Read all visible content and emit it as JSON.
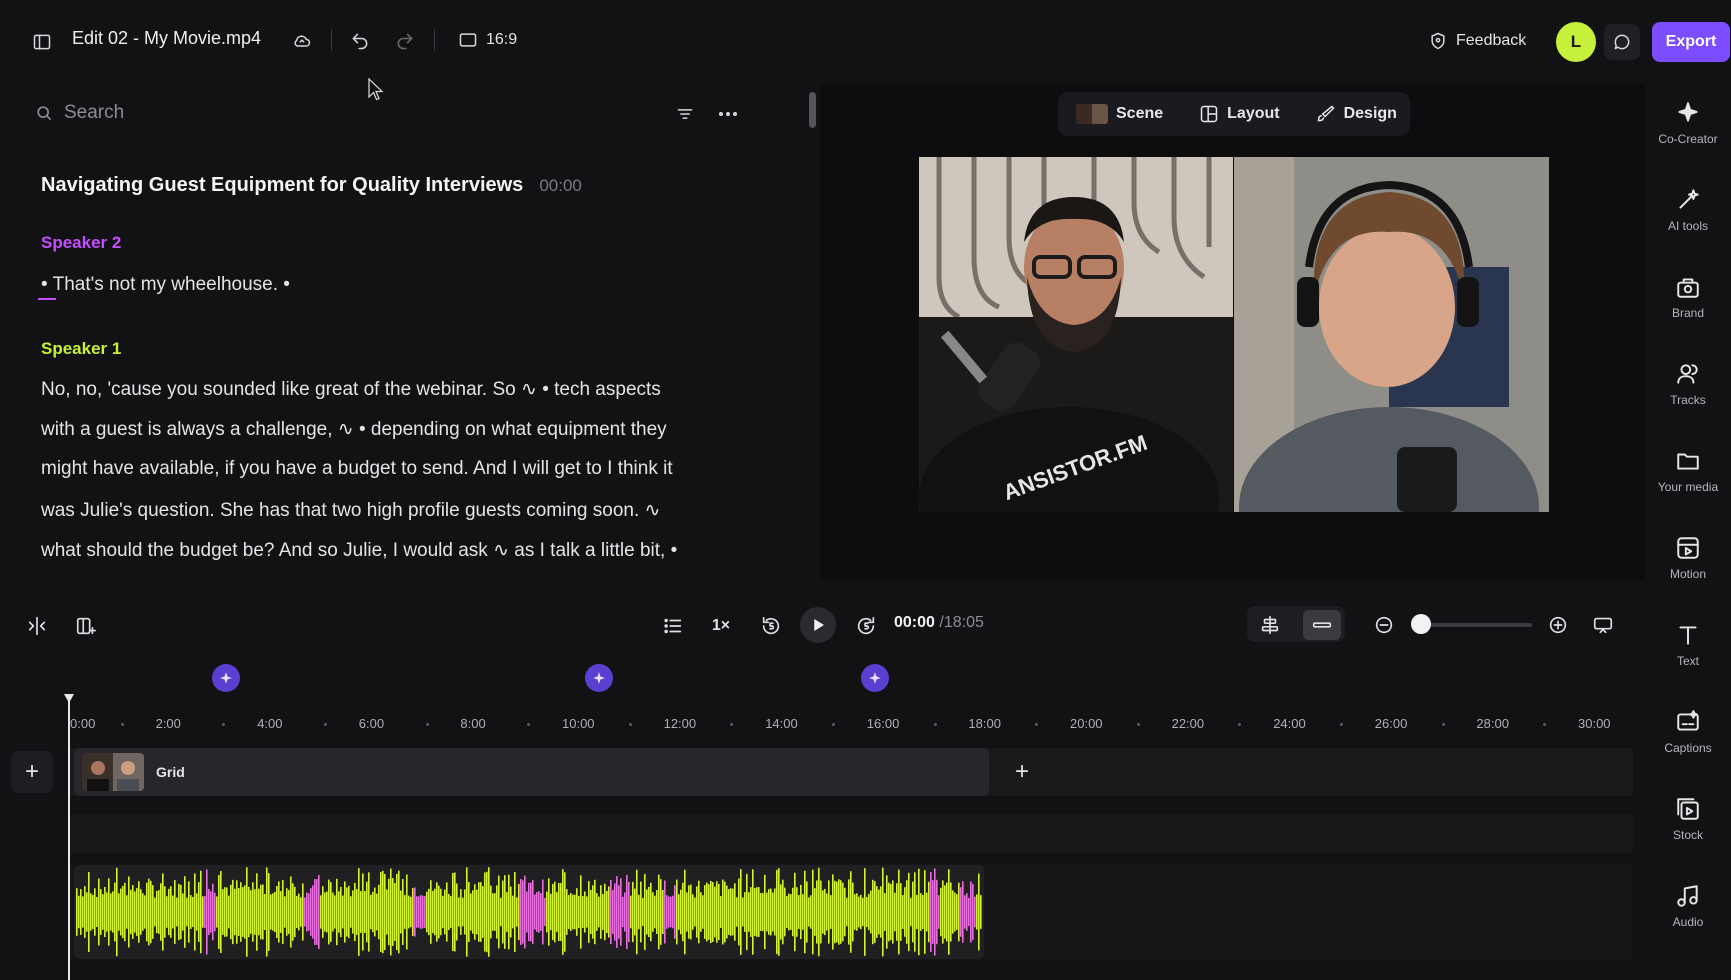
{
  "topbar": {
    "title": "Edit 02 - My Movie.mp4",
    "aspect_ratio": "16:9",
    "feedback_label": "Feedback",
    "avatar_letter": "L",
    "export_label": "Export"
  },
  "transcript": {
    "search_placeholder": "Search",
    "heading": "Navigating Guest Equipment for Quality Interviews",
    "heading_time": "00:00",
    "speaker2_name": "Speaker 2",
    "speaker2_text": "• That's not my  wheelhouse. •",
    "speaker1_name": "Speaker 1",
    "speaker1_lines": [
      "No, no, 'cause you sounded like great of the webinar. So ∿ • tech aspects",
      "with a guest is always a challenge, ∿ • depending on what equipment they",
      "might have available, if you have a budget to send. And I will get to I think it",
      "was Julie's question. She has that two high profile guests coming soon. ∿",
      "what should the budget be? And so Julie, I would ask ∿ as I talk a little bit, •"
    ]
  },
  "preview": {
    "tabs": [
      "Scene",
      "Layout",
      "Design"
    ]
  },
  "sidebar": {
    "items": [
      "Co-Creator",
      "AI tools",
      "Brand",
      "Tracks",
      "Your media",
      "Motion",
      "Text",
      "Captions",
      "Stock",
      "Audio"
    ]
  },
  "transport": {
    "speed": "1×",
    "current_time": "00:00",
    "duration": "/18:05",
    "zoom_level": 0
  },
  "timeline": {
    "ruler": [
      "0:00",
      "2:00",
      "4:00",
      "6:00",
      "8:00",
      "10:00",
      "12:00",
      "14:00",
      "16:00",
      "18:00",
      "20:00",
      "22:00",
      "24:00",
      "26:00",
      "28:00",
      "30:00"
    ],
    "clip_label": "Grid"
  },
  "colors": {
    "accent": "#7c4dff",
    "speaker1": "#c6f13a",
    "speaker2": "#c64dff",
    "waveform": "#d4f52e",
    "waveform_highlight": "#e86ee0"
  }
}
